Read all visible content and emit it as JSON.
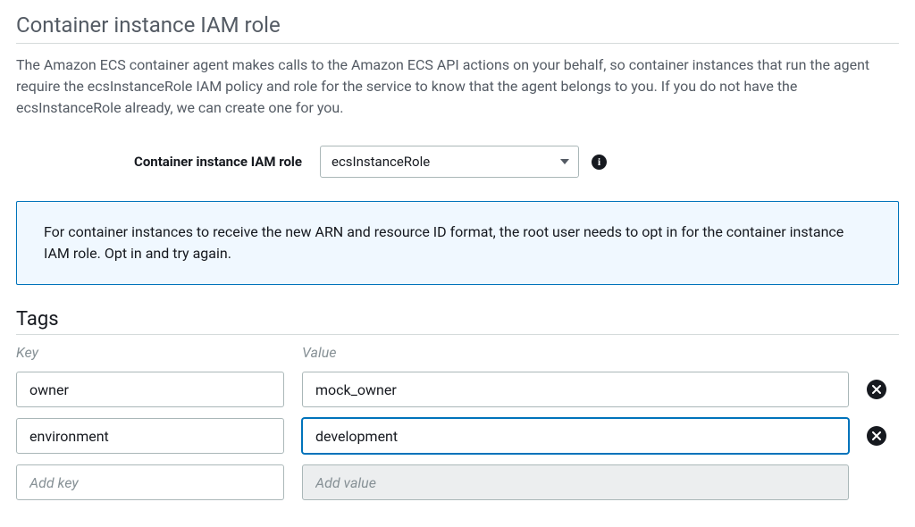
{
  "section": {
    "title": "Container instance IAM role",
    "description": "The Amazon ECS container agent makes calls to the Amazon ECS API actions on your behalf, so container instances that run the agent require the ecsInstanceRole IAM policy and role for the service to know that the agent belongs to you. If you do not have the ecsInstanceRole already, we can create one for you.",
    "field_label": "Container instance IAM role",
    "role_value": "ecsInstanceRole"
  },
  "notice": {
    "text": "For container instances to receive the new ARN and resource ID format, the root user needs to opt in for the container instance IAM role. Opt in and try again."
  },
  "tags": {
    "title": "Tags",
    "key_header": "Key",
    "value_header": "Value",
    "rows": [
      {
        "key": "owner",
        "value": "mock_owner"
      },
      {
        "key": "environment",
        "value": "development"
      }
    ],
    "add_key_placeholder": "Add key",
    "add_value_placeholder": "Add value"
  }
}
